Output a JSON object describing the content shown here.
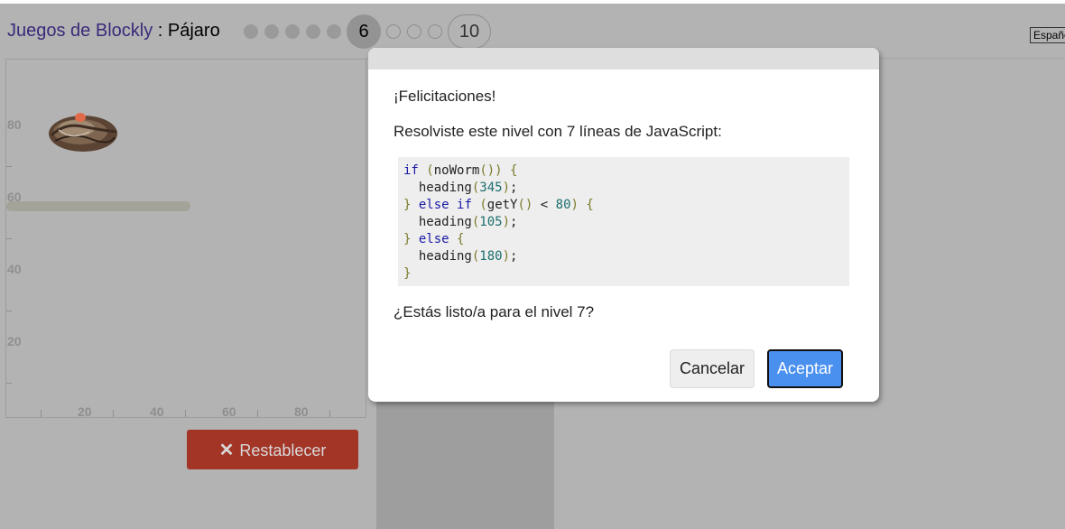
{
  "header": {
    "games_link": "Juegos de Blockly",
    "separator": " : ",
    "game_name": "Pájaro",
    "levels": {
      "completed": 5,
      "current": "6",
      "remaining_dots": 3,
      "max": "10"
    },
    "language": "Español"
  },
  "canvas": {
    "y_ticks": [
      "80",
      "60",
      "40",
      "20"
    ],
    "x_ticks": [
      "20",
      "40",
      "60",
      "80"
    ]
  },
  "controls": {
    "reset_icon": "✕",
    "reset_label": "Restablecer"
  },
  "dialog": {
    "congrats": "¡Felicitaciones!",
    "solved_text": "Resolviste este nivel con 7 líneas de JavaScript:",
    "code_lines": [
      "if (noWorm()) {",
      "  heading(345);",
      "} else if (getY() < 80) {",
      "  heading(105);",
      "} else {",
      "  heading(180);",
      "}"
    ],
    "next_prompt": "¿Estás listo/a para el nivel 7?",
    "cancel_label": "Cancelar",
    "ok_label": "Aceptar"
  }
}
